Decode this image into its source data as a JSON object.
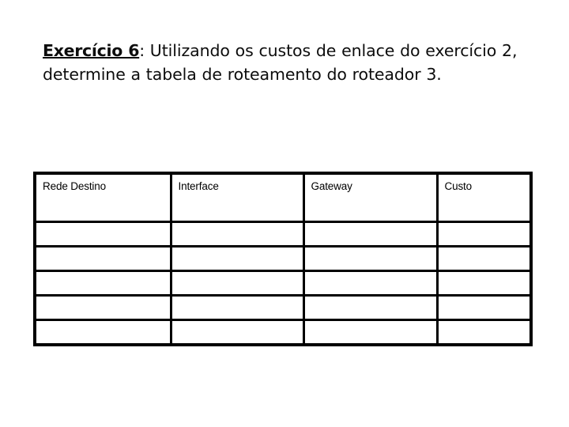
{
  "slide": {
    "background_color": "#ffffff",
    "text_color": "#0d0d0d"
  },
  "question": {
    "label": "Exercício 6",
    "body": ": Utilizando os custos de enlace do exercício 2, determine a tabela de roteamento do roteador 3."
  },
  "table": {
    "border_color": "#000000",
    "columns": [
      {
        "key": "rede_destino",
        "label": "Rede Destino"
      },
      {
        "key": "interface",
        "label": "Interface"
      },
      {
        "key": "gateway",
        "label": "Gateway"
      },
      {
        "key": "custo",
        "label": "Custo"
      }
    ],
    "rows": [
      {
        "rede_destino": "",
        "interface": "",
        "gateway": "",
        "custo": ""
      },
      {
        "rede_destino": "",
        "interface": "",
        "gateway": "",
        "custo": ""
      },
      {
        "rede_destino": "",
        "interface": "",
        "gateway": "",
        "custo": ""
      },
      {
        "rede_destino": "",
        "interface": "",
        "gateway": "",
        "custo": ""
      },
      {
        "rede_destino": "",
        "interface": "",
        "gateway": "",
        "custo": ""
      }
    ]
  }
}
